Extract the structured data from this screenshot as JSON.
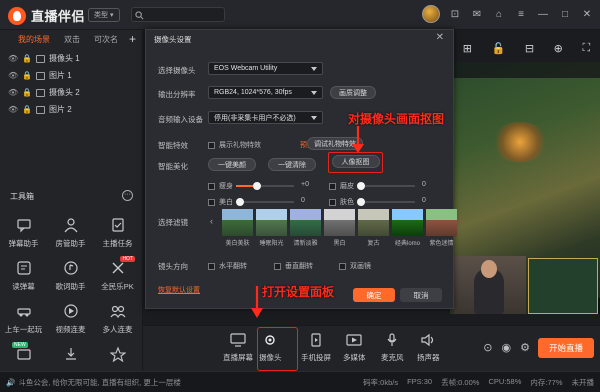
{
  "app": {
    "title": "直播伴侣",
    "type_button": "类型"
  },
  "left": {
    "tabs": [
      "我的场景",
      "双击",
      "可次名"
    ],
    "add": "+",
    "sources": [
      {
        "label": "摄像头 1"
      },
      {
        "label": "图片 1"
      },
      {
        "label": "摄像头 2"
      },
      {
        "label": "图片 2"
      }
    ],
    "tools_title": "工具箱",
    "tools_more": "···",
    "tools": [
      {
        "label": "弹幕助手",
        "icon": "chat-icon"
      },
      {
        "label": "房管助手",
        "icon": "admin-icon"
      },
      {
        "label": "主播任务",
        "icon": "task-icon"
      },
      {
        "label": "读弹幕",
        "icon": "read-danmaku-icon"
      },
      {
        "label": "歌词助手",
        "icon": "lyrics-icon"
      },
      {
        "label": "全民乐PK",
        "icon": "pk-icon",
        "badge": "HOT"
      },
      {
        "label": "上车一起玩",
        "icon": "car-icon"
      },
      {
        "label": "视频连麦",
        "icon": "video-link-icon"
      },
      {
        "label": "多人连麦",
        "icon": "multi-link-icon"
      },
      {
        "label": "",
        "icon": "gift-icon",
        "badge": "NEW"
      },
      {
        "label": "",
        "icon": "download-icon"
      },
      {
        "label": "",
        "icon": "star-icon"
      }
    ]
  },
  "dialog": {
    "title": "摄像头设置",
    "close": "✕",
    "labels": {
      "camera": "选择摄像头",
      "resolution": "输出分辨率",
      "audio": "音频输入设备",
      "smart_effect": "智能特效",
      "smart_beauty": "智能美化",
      "filter": "选择滤镜",
      "mirror": "镜头方向"
    },
    "camera_value": "EOS Webcam Utility",
    "resolution_value": "RGB24, 1024*576, 30fps",
    "resolution_button": "画质调整",
    "audio_value": "停用(非采集卡用户不必选)",
    "show_gift_effect": "展示礼物特效",
    "preview_link": "预览",
    "debug_effect_button": "调试礼物特效",
    "beauty_button": "一键美颜",
    "clear_button": "一键清除",
    "portrait_button": "人像抠图",
    "sliders": [
      {
        "label": "瘦身",
        "value": "+0",
        "fill": 0.35
      },
      {
        "label": "磨皮",
        "value": "0",
        "fill": 0.0
      },
      {
        "label": "美白",
        "value": "0",
        "fill": 0.0
      },
      {
        "label": "肤色",
        "value": "0",
        "fill": 0.0
      }
    ],
    "filters": [
      "美白美肤",
      "睡眠阳光",
      "清新淡雅",
      "黑白",
      "复古",
      "经典lomo",
      "紫色迷情"
    ],
    "mirror_options": [
      "水平翻转",
      "垂直翻转",
      "双画镜"
    ],
    "restore_default": "恢复默认设置",
    "ok": "确定",
    "cancel": "取消"
  },
  "bottom": {
    "items": [
      {
        "label": "直播屏幕",
        "icon": "screen-icon"
      },
      {
        "label": "摄像头",
        "icon": "camera-icon"
      },
      {
        "label": "手机投屏",
        "icon": "phone-cast-icon"
      },
      {
        "label": "多媒体",
        "icon": "media-icon"
      },
      {
        "label": "麦克风",
        "icon": "mic-icon"
      },
      {
        "label": "扬声器",
        "icon": "speaker-icon"
      }
    ],
    "start_live": "开始直播"
  },
  "status": {
    "notice": "斗鱼公会, 给你无限可能, 直播有组织, 更上一层楼",
    "bitrate": "码率:0kb/s",
    "fps": "FPS:30",
    "dropped": "丢帧:0.00%",
    "cpu": "CPU:58%",
    "memory": "内存:77%",
    "not_live": "未开播"
  },
  "annotations": {
    "portrait": "对摄像头画面抠图",
    "open_panel": "打开设置面板"
  },
  "colors": {
    "accent": "#ff6a2a",
    "annotation": "#ff2a1a"
  }
}
